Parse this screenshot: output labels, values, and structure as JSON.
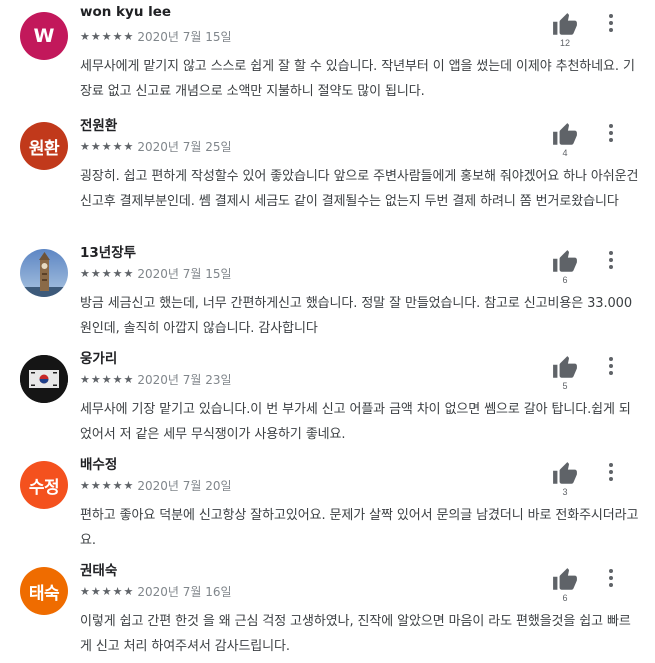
{
  "reviews": [
    {
      "name": "won kyu lee",
      "avatar_text": "W",
      "avatar_color": "#c2185b",
      "avatar_kind": "letter",
      "stars": "★★★★★",
      "date": "2020년 7월 15일",
      "likes": "12",
      "text": "세무사에게 맡기지 않고 스스로 쉽게 잘 할 수 있습니다. 작년부터 이 앱을 썼는데 이제야 추천하네요. 기장료 없고 신고료 개념으로 소액만 지불하니 절약도 많이 됩니다."
    },
    {
      "name": "전원환",
      "avatar_text": "원환",
      "avatar_color": "#c1391b",
      "avatar_kind": "name2",
      "stars": "★★★★★",
      "date": "2020년 7월 25일",
      "likes": "4",
      "text": "굉장히. 쉽고 편하게 작성할수 있어 좋았습니다 앞으로 주변사람들에게 홍보해 줘야겠어요 하나 아쉬운건 신고후 결제부분인데. 쎔 결제시 세금도 같이 결제될수는 없는지 두번 결제 하려니 쫌 번거로왔습니다"
    },
    {
      "name": "13년장투",
      "avatar_text": "",
      "avatar_color": "#6b8fb8",
      "avatar_kind": "clock-tower-photo",
      "stars": "★★★★★",
      "date": "2020년 7월 15일",
      "likes": "6",
      "text": "방금 세금신고 했는데, 너무 간편하게신고 했습니다. 정말 잘 만들었습니다. 참고로 신고비용은 33.000원인데, 솔직히 아깝지 않습니다. 감사합니다"
    },
    {
      "name": "웅가리",
      "avatar_text": "",
      "avatar_color": "#111111",
      "avatar_kind": "flag-photo",
      "stars": "★★★★★",
      "date": "2020년 7월 23일",
      "likes": "5",
      "text": "세무사에 기장 맡기고 있습니다.이 번 부가세 신고 어플과 금액 차이 없으면 쎔으로 갈아 탑니다.쉽게 되었어서 저 같은 세무 무식쟁이가 사용하기 좋네요."
    },
    {
      "name": "배수정",
      "avatar_text": "수정",
      "avatar_color": "#f4511e",
      "avatar_kind": "name2",
      "stars": "★★★★★",
      "date": "2020년 7월 20일",
      "likes": "3",
      "text": "편하고 좋아요 덕분에 신고항상 잘하고있어요. 문제가 살짝 있어서 문의글 남겼더니 바로 전화주시더라고요."
    },
    {
      "name": "권태숙",
      "avatar_text": "태숙",
      "avatar_color": "#ef6c00",
      "avatar_kind": "name2",
      "stars": "★★★★★",
      "date": "2020년 7월 16일",
      "likes": "6",
      "text": "이렇게 쉽고 간편 한것 을 왜 근심 걱정 고생하였나, 진작에 알았으면 마음이 라도 편했을것을 쉽고 빠르게 신고 처리 하여주셔서 감사드립니다."
    }
  ]
}
